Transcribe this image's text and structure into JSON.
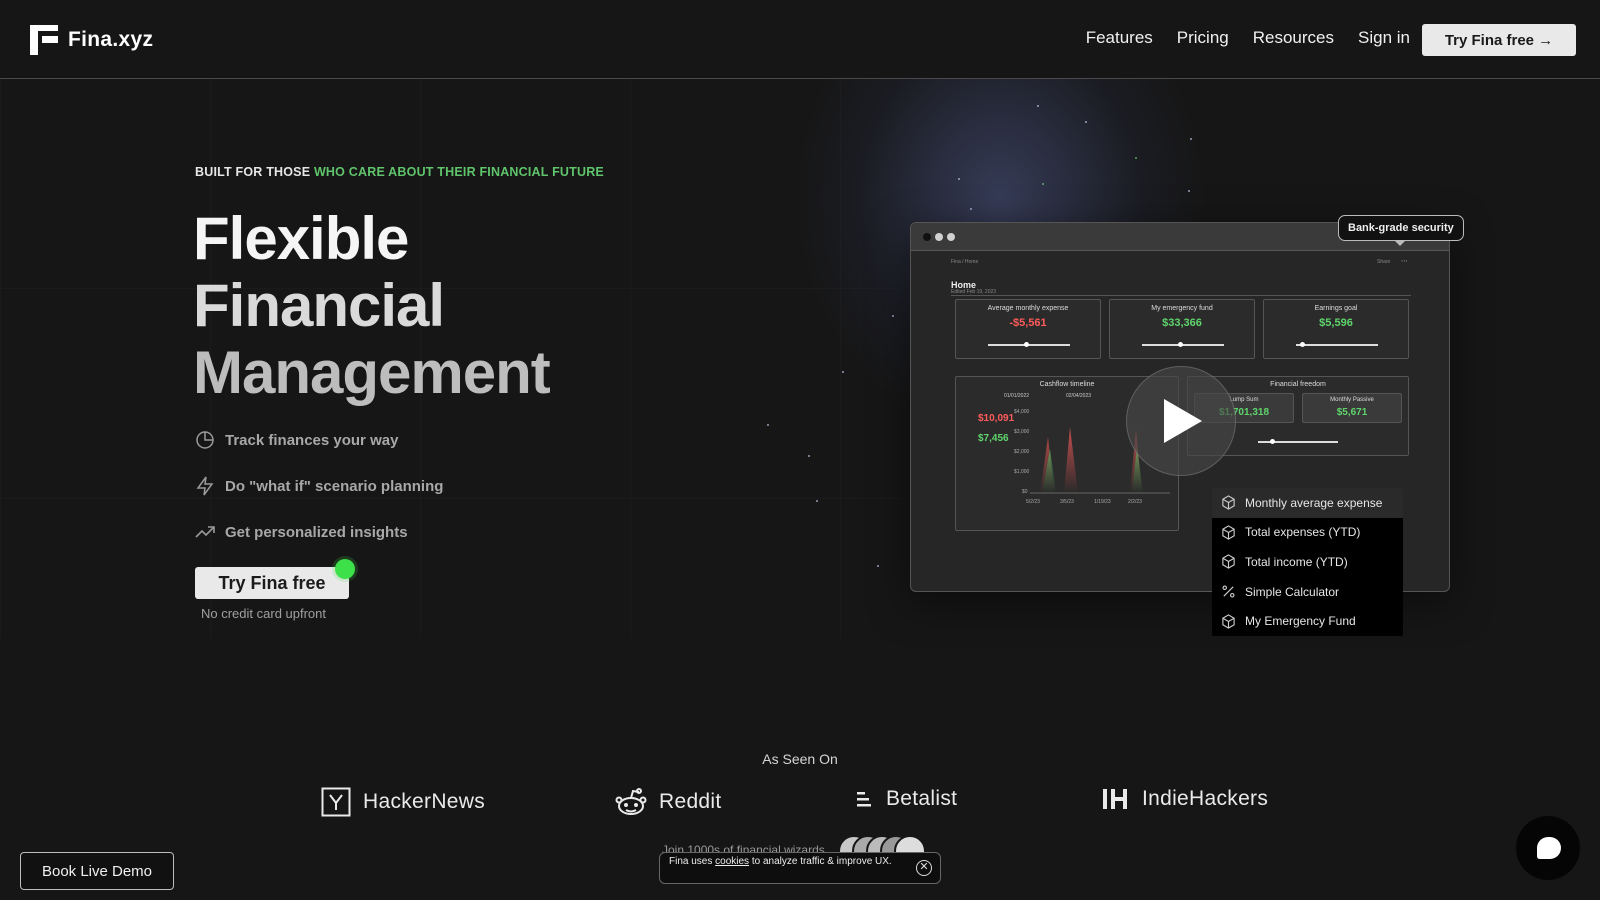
{
  "nav": {
    "logo_text": "Fina.xyz",
    "links": [
      "Features",
      "Pricing",
      "Resources",
      "Sign in"
    ],
    "cta_label": "Try Fina free →"
  },
  "hero": {
    "eyebrow_white": "BUILT FOR THOSE ",
    "eyebrow_green": "WHO CARE ABOUT THEIR FINANCIAL FUTURE",
    "title_lines": [
      "Flexible",
      "Financial",
      "Management"
    ],
    "features": [
      {
        "icon": "pie-chart-icon",
        "label": "Track finances your way"
      },
      {
        "icon": "lightning-icon",
        "label": "Do \"what if\" scenario planning"
      },
      {
        "icon": "trending-up-icon",
        "label": "Get personalized insights"
      }
    ],
    "cta_label": "Try Fina free",
    "cta_sub": "No credit card upfront"
  },
  "mock": {
    "breadcrumb": "Fina / Home",
    "share": "Share",
    "page_title": "Home",
    "edited": "Edited Feb 19, 2023",
    "cards": [
      {
        "title": "Average monthly expense",
        "value": "-$5,561",
        "color": "#ff5b5b"
      },
      {
        "title": "My emergency fund",
        "value": "$33,366",
        "color": "#5fd46c"
      },
      {
        "title": "Earnings goal",
        "value": "$5,596",
        "color": "#5fd46c"
      }
    ],
    "cashflow": {
      "title": "Cashflow timeline",
      "start_date": "01/01/2022",
      "end_date": "02/04/2023",
      "expense_value": "$10,091",
      "income_value": "$7,456",
      "y_ticks": [
        "$4,000",
        "$3,000",
        "$2,000",
        "$1,000",
        "$0"
      ],
      "x_ticks": [
        "5/2/23",
        "3/5/23",
        "1/19/23",
        "2/2/23"
      ]
    },
    "freedom": {
      "title": "Financial freedom",
      "lump_label": "Lump Sum",
      "lump_value": "$1,701,318",
      "passive_label": "Monthly Passive",
      "passive_value": "$5,671"
    }
  },
  "badge_label": "Bank-grade security",
  "widget_menu": [
    {
      "icon": "cube-icon",
      "label": "Monthly average expense",
      "active": true
    },
    {
      "icon": "cube-icon",
      "label": "Total expenses (YTD)"
    },
    {
      "icon": "cube-icon",
      "label": "Total income (YTD)"
    },
    {
      "icon": "percent-icon",
      "label": "Simple Calculator"
    },
    {
      "icon": "cube-icon",
      "label": "My Emergency Fund"
    }
  ],
  "seen_on": {
    "heading": "As Seen On",
    "brands": [
      "HackerNews",
      "Reddit",
      "Betalist",
      "IndieHackers"
    ]
  },
  "join_text": "Join 1000s of financial wizards",
  "cookie": {
    "prefix": "Fina uses ",
    "link": "cookies",
    "suffix": " to analyze traffic & improve UX."
  },
  "demo_button": "Book Live Demo",
  "colors": {
    "accent_green": "#5fc46b",
    "red": "#ff5b5b",
    "background": "#161616"
  }
}
